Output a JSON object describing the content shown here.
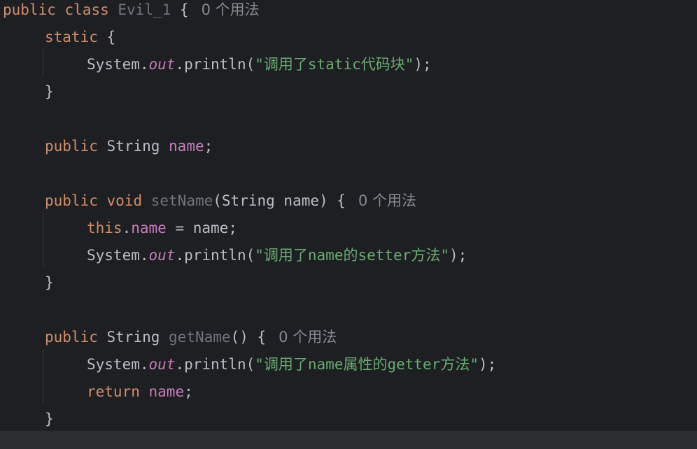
{
  "lines": [
    {
      "kw": "public",
      "kw2": "class",
      "cls": "Evil_1",
      "brace": "{",
      "hint": "0 个用法"
    },
    {
      "kw": "static",
      "brace": "{"
    },
    {
      "obj": "System.",
      "field": "out",
      "call": ".println(",
      "str": "\"调用了static代码块\"",
      "end": ");"
    },
    {
      "brace": "}"
    },
    {
      "kw": "public",
      "type": "String",
      "field": "name",
      "end": ";"
    },
    {
      "kw": "public",
      "kw2": "void",
      "method": "setName",
      "params": "(String name)",
      "brace": "{",
      "hint": "0 个用法"
    },
    {
      "kw": "this",
      "dot": ".",
      "field": "name",
      "rest": " = name;"
    },
    {
      "obj": "System.",
      "field": "out",
      "call": ".println(",
      "str": "\"调用了name的setter方法\"",
      "end": ");"
    },
    {
      "brace": "}"
    },
    {
      "kw": "public",
      "type": "String",
      "method": "getName",
      "params": "()",
      "brace": "{",
      "hint": "0 个用法"
    },
    {
      "obj": "System.",
      "field": "out",
      "call": ".println(",
      "str": "\"调用了name属性的getter方法\"",
      "end": ");"
    },
    {
      "kw": "return",
      "field": "name",
      "end": ";"
    },
    {
      "brace": "}"
    }
  ]
}
